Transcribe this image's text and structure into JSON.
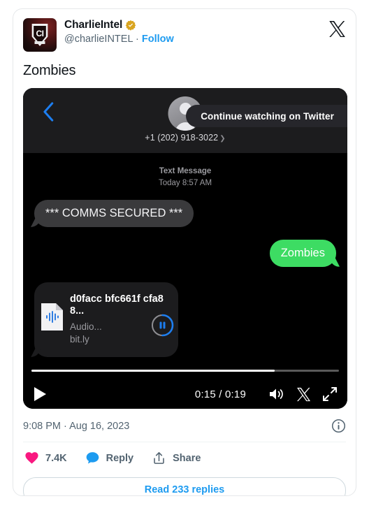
{
  "card": {
    "author": {
      "display_name": "CharlieIntel",
      "handle": "@charlieINTEL",
      "separator": "·",
      "follow_label": "Follow",
      "verified_badge": "verified-gold-check",
      "avatar_initials": "CI"
    },
    "platform_logo": "x-logo",
    "tweet_text": "Zombies",
    "timestamp": "9:08 PM · Aug 16, 2023",
    "info_icon": "info-circle-icon",
    "actions": [
      {
        "icon": "heart-icon",
        "label": "7.4K",
        "color": "#f91880"
      },
      {
        "icon": "reply-bubble-icon",
        "label": "Reply",
        "color": "#1d9bf0"
      },
      {
        "icon": "share-icon",
        "label": "Share",
        "color": "#536471"
      }
    ],
    "read_replies_label": "Read 233 replies"
  },
  "video": {
    "overlay_pill": "Continue watching on Twitter",
    "imessage": {
      "back_icon": "chevron-left-icon",
      "contact_avatar": "contact-silhouette-icon",
      "phone_number": "+1 (202) 918-3022",
      "disclosure_icon": "chevron-right-icon",
      "thread_type": "Text Message",
      "thread_time": "Today 8:57 AM",
      "messages": [
        {
          "side": "left",
          "kind": "text",
          "text": "*** COMMS SECURED ***"
        },
        {
          "side": "right",
          "kind": "text",
          "text": "Zombies"
        }
      ],
      "attachment": {
        "icon": "audio-document-icon",
        "filename": "d0facc bfc661f cfa88...",
        "subtitle": "Audio...",
        "link": "bit.ly",
        "pause_icon": "pause-icon"
      }
    },
    "controls": {
      "play_icon": "play-icon",
      "timecode": "0:15 / 0:19",
      "volume_icon": "volume-icon",
      "x_icon": "x-logo-icon",
      "fullscreen_icon": "fullscreen-expand-icon",
      "progress_percent": 79
    }
  },
  "colors": {
    "brand_blue": "#1d9bf0",
    "heart_pink": "#f91880",
    "imessage_green": "#3ddc63",
    "text_primary": "#0f1419",
    "text_secondary": "#536471"
  }
}
